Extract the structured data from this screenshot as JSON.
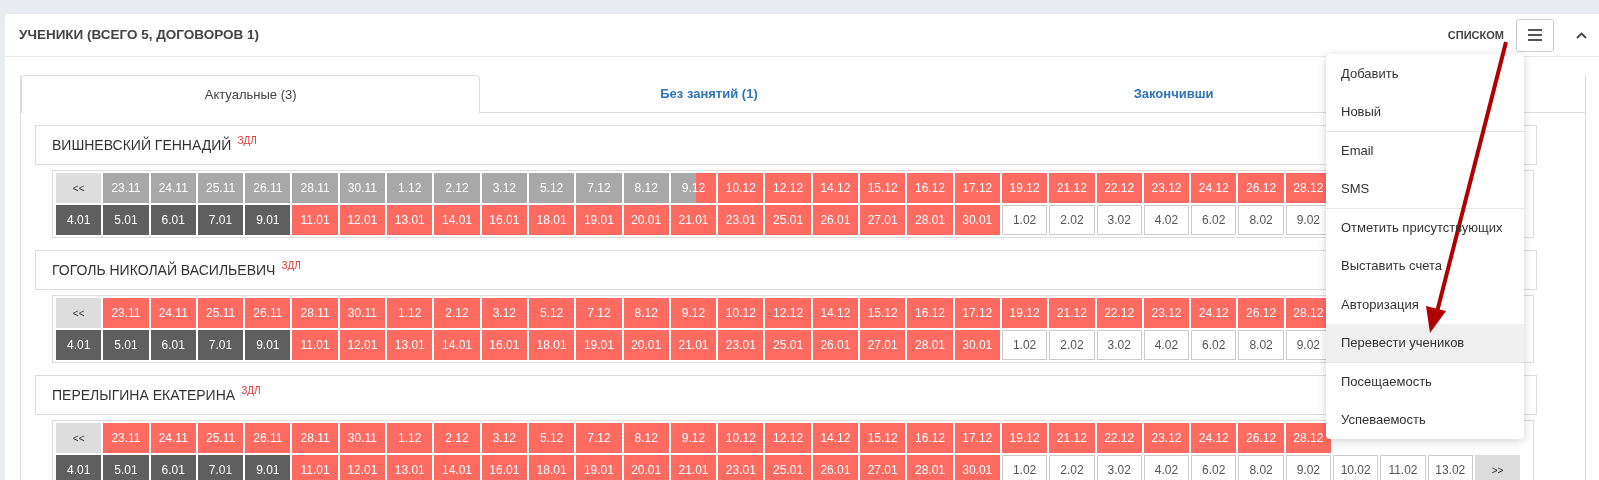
{
  "panel": {
    "title": "УЧЕНИКИ (ВСЕГО 5, ДОГОВОРОВ 1)",
    "view_label": "СПИСКОМ"
  },
  "tabs": [
    {
      "label": "Актуальные (3)",
      "selected": true
    },
    {
      "label": "Без занятий (1)",
      "selected": false
    },
    {
      "label": "Закончивши",
      "selected": false
    }
  ],
  "students": [
    {
      "name": "ВИШНЕВСКИЙ ГЕННАДИЙ",
      "tag": "ЗДЛ",
      "rows": [
        [
          {
            "text": "<<",
            "kind": "nav"
          },
          {
            "text": "23.11",
            "kind": "past"
          },
          {
            "text": "24.11",
            "kind": "past"
          },
          {
            "text": "25.11",
            "kind": "past"
          },
          {
            "text": "26.11",
            "kind": "past"
          },
          {
            "text": "28.11",
            "kind": "past"
          },
          {
            "text": "30.11",
            "kind": "past"
          },
          {
            "text": "1.12",
            "kind": "past"
          },
          {
            "text": "2.12",
            "kind": "past"
          },
          {
            "text": "3.12",
            "kind": "past"
          },
          {
            "text": "5.12",
            "kind": "past"
          },
          {
            "text": "7.12",
            "kind": "past"
          },
          {
            "text": "8.12",
            "kind": "past"
          },
          {
            "text": "9.12",
            "kind": "split"
          },
          {
            "text": "10.12",
            "kind": "debt"
          },
          {
            "text": "12.12",
            "kind": "debt"
          },
          {
            "text": "14.12",
            "kind": "debt"
          },
          {
            "text": "15.12",
            "kind": "debt"
          },
          {
            "text": "16.12",
            "kind": "debt"
          },
          {
            "text": "17.12",
            "kind": "debt"
          },
          {
            "text": "19.12",
            "kind": "debt"
          },
          {
            "text": "21.12",
            "kind": "debt"
          },
          {
            "text": "22.12",
            "kind": "debt"
          },
          {
            "text": "23.12",
            "kind": "debt"
          },
          {
            "text": "24.12",
            "kind": "debt"
          },
          {
            "text": "26.12",
            "kind": "debt"
          },
          {
            "text": "28.12",
            "kind": "debt"
          }
        ],
        [
          {
            "text": "4.01",
            "kind": "dark"
          },
          {
            "text": "5.01",
            "kind": "dark"
          },
          {
            "text": "6.01",
            "kind": "dark"
          },
          {
            "text": "7.01",
            "kind": "dark"
          },
          {
            "text": "9.01",
            "kind": "dark"
          },
          {
            "text": "11.01",
            "kind": "debt"
          },
          {
            "text": "12.01",
            "kind": "debt"
          },
          {
            "text": "13.01",
            "kind": "debt"
          },
          {
            "text": "14.01",
            "kind": "debt"
          },
          {
            "text": "16.01",
            "kind": "debt"
          },
          {
            "text": "18.01",
            "kind": "debt"
          },
          {
            "text": "19.01",
            "kind": "debt"
          },
          {
            "text": "20.01",
            "kind": "debt"
          },
          {
            "text": "21.01",
            "kind": "debt"
          },
          {
            "text": "23.01",
            "kind": "debt"
          },
          {
            "text": "25.01",
            "kind": "debt"
          },
          {
            "text": "26.01",
            "kind": "debt"
          },
          {
            "text": "27.01",
            "kind": "debt"
          },
          {
            "text": "28.01",
            "kind": "debt"
          },
          {
            "text": "30.01",
            "kind": "debt"
          },
          {
            "text": "1.02",
            "kind": "future"
          },
          {
            "text": "2.02",
            "kind": "future"
          },
          {
            "text": "3.02",
            "kind": "future"
          },
          {
            "text": "4.02",
            "kind": "future"
          },
          {
            "text": "6.02",
            "kind": "future"
          },
          {
            "text": "8.02",
            "kind": "future"
          },
          {
            "text": "9.02",
            "kind": "future"
          }
        ]
      ]
    },
    {
      "name": "ГОГОЛЬ НИКОЛАЙ ВАСИЛЬЕВИЧ",
      "tag": "ЗДЛ",
      "rows": [
        [
          {
            "text": "<<",
            "kind": "nav"
          },
          {
            "text": "23.11",
            "kind": "debt"
          },
          {
            "text": "24.11",
            "kind": "debt"
          },
          {
            "text": "25.11",
            "kind": "debt"
          },
          {
            "text": "26.11",
            "kind": "debt"
          },
          {
            "text": "28.11",
            "kind": "debt"
          },
          {
            "text": "30.11",
            "kind": "debt"
          },
          {
            "text": "1.12",
            "kind": "debt"
          },
          {
            "text": "2.12",
            "kind": "debt"
          },
          {
            "text": "3.12",
            "kind": "debt"
          },
          {
            "text": "5.12",
            "kind": "debt"
          },
          {
            "text": "7.12",
            "kind": "debt"
          },
          {
            "text": "8.12",
            "kind": "debt"
          },
          {
            "text": "9.12",
            "kind": "debt"
          },
          {
            "text": "10.12",
            "kind": "debt"
          },
          {
            "text": "12.12",
            "kind": "debt"
          },
          {
            "text": "14.12",
            "kind": "debt"
          },
          {
            "text": "15.12",
            "kind": "debt"
          },
          {
            "text": "16.12",
            "kind": "debt"
          },
          {
            "text": "17.12",
            "kind": "debt"
          },
          {
            "text": "19.12",
            "kind": "debt"
          },
          {
            "text": "21.12",
            "kind": "debt"
          },
          {
            "text": "22.12",
            "kind": "debt"
          },
          {
            "text": "23.12",
            "kind": "debt"
          },
          {
            "text": "24.12",
            "kind": "debt"
          },
          {
            "text": "26.12",
            "kind": "debt"
          },
          {
            "text": "28.12",
            "kind": "debt"
          }
        ],
        [
          {
            "text": "4.01",
            "kind": "dark"
          },
          {
            "text": "5.01",
            "kind": "dark"
          },
          {
            "text": "6.01",
            "kind": "dark"
          },
          {
            "text": "7.01",
            "kind": "dark"
          },
          {
            "text": "9.01",
            "kind": "dark"
          },
          {
            "text": "11.01",
            "kind": "debt"
          },
          {
            "text": "12.01",
            "kind": "debt"
          },
          {
            "text": "13.01",
            "kind": "debt"
          },
          {
            "text": "14.01",
            "kind": "debt"
          },
          {
            "text": "16.01",
            "kind": "debt"
          },
          {
            "text": "18.01",
            "kind": "debt"
          },
          {
            "text": "19.01",
            "kind": "debt"
          },
          {
            "text": "20.01",
            "kind": "debt"
          },
          {
            "text": "21.01",
            "kind": "debt"
          },
          {
            "text": "23.01",
            "kind": "debt"
          },
          {
            "text": "25.01",
            "kind": "debt"
          },
          {
            "text": "26.01",
            "kind": "debt"
          },
          {
            "text": "27.01",
            "kind": "debt"
          },
          {
            "text": "28.01",
            "kind": "debt"
          },
          {
            "text": "30.01",
            "kind": "debt"
          },
          {
            "text": "1.02",
            "kind": "future"
          },
          {
            "text": "2.02",
            "kind": "future"
          },
          {
            "text": "3.02",
            "kind": "future"
          },
          {
            "text": "4.02",
            "kind": "future"
          },
          {
            "text": "6.02",
            "kind": "future"
          },
          {
            "text": "8.02",
            "kind": "future"
          },
          {
            "text": "9.02",
            "kind": "future"
          }
        ]
      ]
    },
    {
      "name": "ПЕРЕЛЫГИНА ЕКАТЕРИНА",
      "tag": "ЗДЛ",
      "rows": [
        [
          {
            "text": "<<",
            "kind": "nav"
          },
          {
            "text": "23.11",
            "kind": "debt"
          },
          {
            "text": "24.11",
            "kind": "debt"
          },
          {
            "text": "25.11",
            "kind": "debt"
          },
          {
            "text": "26.11",
            "kind": "debt"
          },
          {
            "text": "28.11",
            "kind": "debt"
          },
          {
            "text": "30.11",
            "kind": "debt"
          },
          {
            "text": "1.12",
            "kind": "debt"
          },
          {
            "text": "2.12",
            "kind": "debt"
          },
          {
            "text": "3.12",
            "kind": "debt"
          },
          {
            "text": "5.12",
            "kind": "debt"
          },
          {
            "text": "7.12",
            "kind": "debt"
          },
          {
            "text": "8.12",
            "kind": "debt"
          },
          {
            "text": "9.12",
            "kind": "debt"
          },
          {
            "text": "10.12",
            "kind": "debt"
          },
          {
            "text": "12.12",
            "kind": "debt"
          },
          {
            "text": "14.12",
            "kind": "debt"
          },
          {
            "text": "15.12",
            "kind": "debt"
          },
          {
            "text": "16.12",
            "kind": "debt"
          },
          {
            "text": "17.12",
            "kind": "debt"
          },
          {
            "text": "19.12",
            "kind": "debt"
          },
          {
            "text": "21.12",
            "kind": "debt"
          },
          {
            "text": "22.12",
            "kind": "debt"
          },
          {
            "text": "23.12",
            "kind": "debt"
          },
          {
            "text": "24.12",
            "kind": "debt"
          },
          {
            "text": "26.12",
            "kind": "debt"
          },
          {
            "text": "28.12",
            "kind": "debt"
          }
        ],
        [
          {
            "text": "4.01",
            "kind": "dark"
          },
          {
            "text": "5.01",
            "kind": "dark"
          },
          {
            "text": "6.01",
            "kind": "dark"
          },
          {
            "text": "7.01",
            "kind": "dark"
          },
          {
            "text": "9.01",
            "kind": "dark"
          },
          {
            "text": "11.01",
            "kind": "debt"
          },
          {
            "text": "12.01",
            "kind": "debt"
          },
          {
            "text": "13.01",
            "kind": "debt"
          },
          {
            "text": "14.01",
            "kind": "debt"
          },
          {
            "text": "16.01",
            "kind": "debt"
          },
          {
            "text": "18.01",
            "kind": "debt"
          },
          {
            "text": "19.01",
            "kind": "debt"
          },
          {
            "text": "20.01",
            "kind": "debt"
          },
          {
            "text": "21.01",
            "kind": "debt"
          },
          {
            "text": "23.01",
            "kind": "debt"
          },
          {
            "text": "25.01",
            "kind": "debt"
          },
          {
            "text": "26.01",
            "kind": "debt"
          },
          {
            "text": "27.01",
            "kind": "debt"
          },
          {
            "text": "28.01",
            "kind": "debt"
          },
          {
            "text": "30.01",
            "kind": "debt"
          },
          {
            "text": "1.02",
            "kind": "future"
          },
          {
            "text": "2.02",
            "kind": "future"
          },
          {
            "text": "3.02",
            "kind": "future"
          },
          {
            "text": "4.02",
            "kind": "future"
          },
          {
            "text": "6.02",
            "kind": "future"
          },
          {
            "text": "8.02",
            "kind": "future"
          },
          {
            "text": "9.02",
            "kind": "future"
          },
          {
            "text": "10.02",
            "kind": "future"
          },
          {
            "text": "11.02",
            "kind": "future"
          },
          {
            "text": "13.02",
            "kind": "future"
          },
          {
            "text": ">>",
            "kind": "nav"
          }
        ]
      ]
    }
  ],
  "menu": {
    "groups": [
      [
        {
          "label": "Добавить",
          "selected": false
        },
        {
          "label": "Новый",
          "selected": false
        }
      ],
      [
        {
          "label": "Email",
          "selected": false
        },
        {
          "label": "SMS",
          "selected": false
        }
      ],
      [
        {
          "label": "Отметить присутствующих",
          "selected": false
        },
        {
          "label": "Выставить счета",
          "selected": false
        },
        {
          "label": "Авторизация",
          "selected": false
        },
        {
          "label": "Перевести учеников",
          "selected": true
        }
      ],
      [
        {
          "label": "Посещаемость",
          "selected": false
        },
        {
          "label": "Успеваемость",
          "selected": false
        }
      ]
    ]
  }
}
